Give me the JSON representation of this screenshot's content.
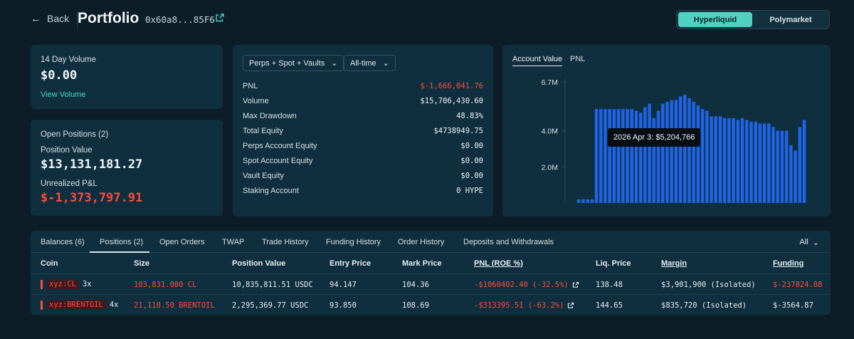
{
  "header": {
    "back_label": "Back",
    "title": "Portfolio",
    "address": "0x60a8...85F6",
    "platforms": [
      "Hyperliquid",
      "Polymarket"
    ],
    "active_platform": "Hyperliquid"
  },
  "volume_card": {
    "label": "14 Day Volume",
    "value": "$0.00",
    "link": "View Volume"
  },
  "positions_card": {
    "title": "Open Positions (2)",
    "position_value_label": "Position Value",
    "position_value": "$13,131,181.27",
    "unrealized_label": "Unrealized P&L",
    "unrealized_value": "$-1,373,797.91"
  },
  "stats": {
    "filter_scope": "Perps + Spot + Vaults",
    "filter_range": "All-time",
    "rows": [
      {
        "label": "PNL",
        "value": "$-1,666,041.76",
        "negative": true
      },
      {
        "label": "Volume",
        "value": "$15,706,430.60",
        "negative": false
      },
      {
        "label": "Max Drawdown",
        "value": "48.83%",
        "negative": false
      },
      {
        "label": "Total Equity",
        "value": "$4738949.75",
        "negative": false
      },
      {
        "label": "Perps Account Equity",
        "value": "$0.00",
        "negative": false
      },
      {
        "label": "Spot Account Equity",
        "value": "$0.00",
        "negative": false
      },
      {
        "label": "Vault Equity",
        "value": "$0.00",
        "negative": false
      },
      {
        "label": "Staking Account",
        "value": "0 HYPE",
        "negative": false
      }
    ]
  },
  "chart": {
    "tabs": [
      "Account Value",
      "PNL"
    ],
    "active_tab": "Account Value",
    "tooltip": "2026 Apr 3: $5,204,766",
    "bar_color": "#1f63e6"
  },
  "chart_data": {
    "type": "bar",
    "title": "",
    "xlabel": "",
    "ylabel": "",
    "yticks": [
      {
        "value": 6.7,
        "label": "6.7M"
      },
      {
        "value": 4.0,
        "label": "4.0M"
      },
      {
        "value": 2.0,
        "label": "2.0M"
      }
    ],
    "ylim": [
      0,
      6.9
    ],
    "units": "millions USD",
    "values": [
      0.2,
      0.2,
      0.2,
      0.2,
      5.2,
      5.2,
      5.2,
      5.2,
      5.2,
      5.2,
      5.2,
      5.2,
      5.2,
      5.1,
      5.0,
      5.3,
      5.5,
      4.7,
      5.1,
      5.5,
      5.6,
      5.7,
      5.7,
      5.9,
      6.0,
      5.8,
      5.6,
      5.4,
      5.2,
      5.1,
      4.8,
      4.8,
      4.8,
      4.7,
      4.7,
      4.7,
      4.6,
      4.7,
      4.6,
      4.5,
      4.5,
      4.4,
      4.4,
      4.4,
      4.2,
      4.0,
      4.0,
      4.0,
      3.2,
      2.9,
      4.2,
      4.6
    ]
  },
  "positions_table": {
    "tabs": [
      "Balances (6)",
      "Positions (2)",
      "Open Orders",
      "TWAP",
      "Trade History",
      "Funding History",
      "Order History",
      "Deposits and Withdrawals"
    ],
    "active_tab": "Positions (2)",
    "filter": "All",
    "columns": [
      "Coin",
      "Size",
      "Position Value",
      "Entry Price",
      "Mark Price",
      "PNL (ROE %)",
      "Liq. Price",
      "Margin",
      "Funding"
    ],
    "rows": [
      {
        "coin": "xyz:CL",
        "leverage": "3x",
        "size": "103,831.080 CL",
        "position_value": "10,835,811.51 USDC",
        "entry_price": "94.147",
        "mark_price": "104.36",
        "pnl": "-$1060402.40 (-32.5%)",
        "liq_price": "138.48",
        "margin": "$3,901,900 (Isolated)",
        "funding": "$-237824.08",
        "funding_negative": true
      },
      {
        "coin": "xyz:BRENTOIL",
        "leverage": "4x",
        "size": "21,118.50 BRENTOIL",
        "position_value": "2,295,369.77 USDC",
        "entry_price": "93.850",
        "mark_price": "108.69",
        "pnl": "-$313395.51 (-63.2%)",
        "liq_price": "144.65",
        "margin": "$835,720 (Isolated)",
        "funding": "$-3564.87",
        "funding_negative": false
      }
    ]
  }
}
